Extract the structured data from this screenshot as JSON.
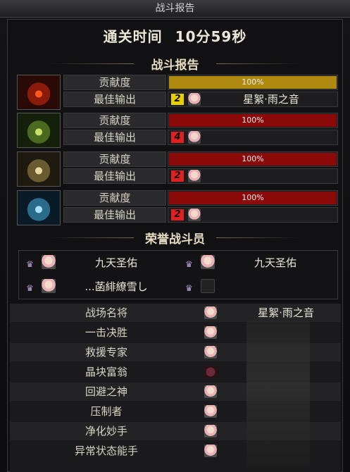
{
  "window": {
    "title": "战斗报告"
  },
  "clear_time": {
    "label": "通关时间",
    "value": "10分59秒"
  },
  "report": {
    "title": "战斗报告",
    "contribution_label": "贡献度",
    "best_output_label": "最佳输出",
    "rows": [
      {
        "boss_icon": "red-demon-icon",
        "contribution_percent": 100,
        "contribution_text": "100%",
        "bar_color": "#b08a10",
        "rank": "2",
        "rank_color": "#e8d000",
        "player": "星絮·雨之音"
      },
      {
        "boss_icon": "green-demon-icon",
        "contribution_percent": 100,
        "contribution_text": "100%",
        "bar_color": "#8a0a0a",
        "rank": "4",
        "rank_color": "#e02020",
        "player": ""
      },
      {
        "boss_icon": "gold-demon-icon",
        "contribution_percent": 100,
        "contribution_text": "100%",
        "bar_color": "#8a0a0a",
        "rank": "2",
        "rank_color": "#e02020",
        "player": ""
      },
      {
        "boss_icon": "blue-demon-icon",
        "contribution_percent": 100,
        "contribution_text": "100%",
        "bar_color": "#8a0a0a",
        "rank": "2",
        "rank_color": "#e02020",
        "player": ""
      }
    ]
  },
  "honor": {
    "title": "荣誉战斗员",
    "members": [
      {
        "name": "九天圣佑",
        "avatar": "girl-avatar-icon"
      },
      {
        "name": "九天圣佑",
        "avatar": "girl-avatar-icon"
      },
      {
        "name": "...菡緋繚雪し",
        "avatar": "girl-avatar-icon"
      },
      {
        "name": "",
        "avatar": "empty-slot-icon"
      }
    ]
  },
  "awards": [
    {
      "title": "战场名将",
      "player": "星絮·雨之音",
      "avatar": "light"
    },
    {
      "title": "一击决胜",
      "player": "",
      "avatar": "light"
    },
    {
      "title": "救援专家",
      "player": "",
      "avatar": "light"
    },
    {
      "title": "晶块富翁",
      "player": "",
      "avatar": "dark"
    },
    {
      "title": "回避之神",
      "player": "",
      "avatar": "light"
    },
    {
      "title": "压制者",
      "player": "",
      "avatar": "light"
    },
    {
      "title": "净化妙手",
      "player": "",
      "avatar": "light"
    },
    {
      "title": "异常状态能手",
      "player": "",
      "avatar": "light"
    }
  ]
}
